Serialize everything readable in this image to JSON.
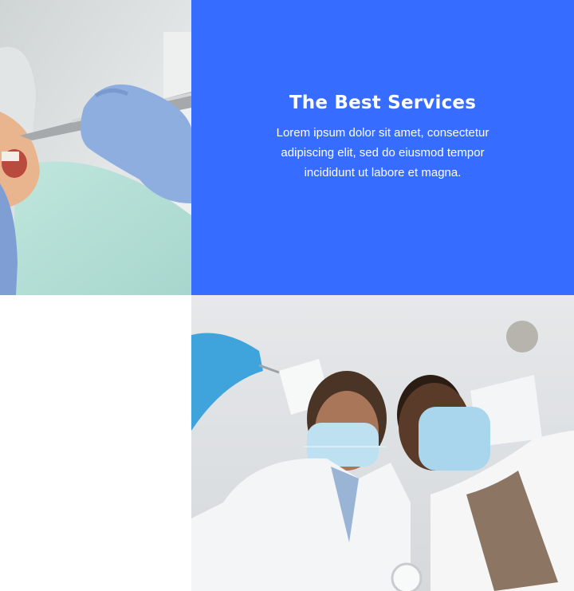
{
  "promo": {
    "title": "The Best Services",
    "lines": [
      "Lorem ipsum dolor sit amet, consectetur",
      "adipiscing elit, sed do eiusmod tempor",
      "incididunt ut labore et magna."
    ],
    "background": "#366cff"
  },
  "images": {
    "top": "dental-procedure-photo",
    "bottom": "two-dentists-photo"
  }
}
